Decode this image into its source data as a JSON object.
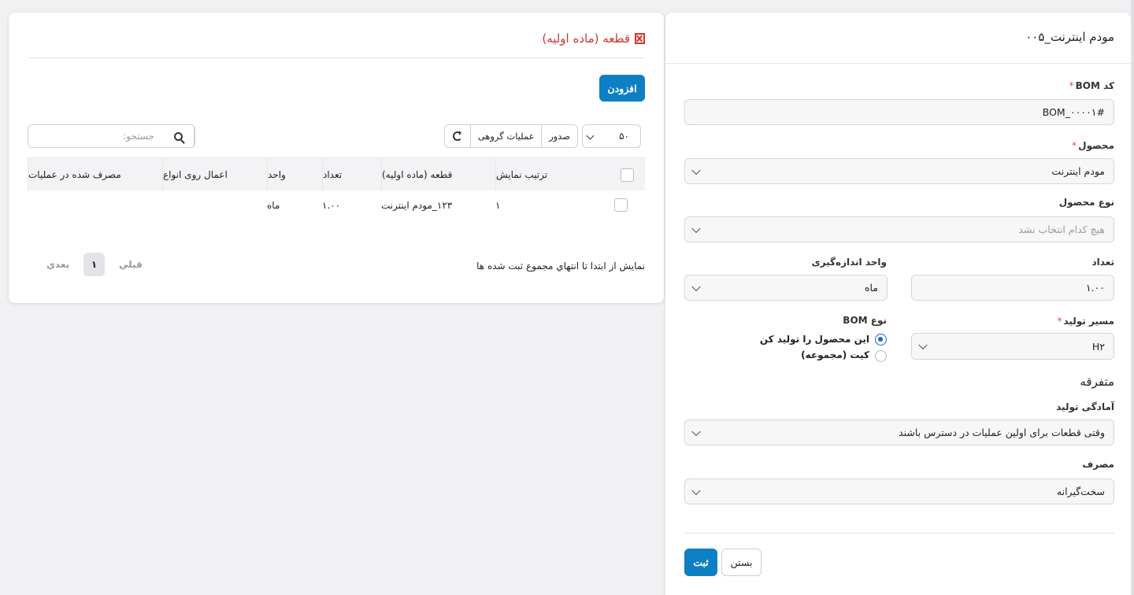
{
  "form": {
    "title": "۰۰۵_مودم اینترنت",
    "bom_code_label": "کد BOM",
    "bom_code_value": "BOM_۰۰۰۰۱#",
    "product_label": "محصول",
    "product_value": "مودم اینترنت",
    "product_type_label": "نوع محصول",
    "product_type_placeholder": "هیچ کدام انتخاب نشد",
    "quantity_label": "تعداد",
    "quantity_value": "۱.۰۰",
    "uom_label": "واحد اندازه‌گیری",
    "uom_value": "ماه",
    "route_label": "مسیر تولید",
    "route_value": "H۲",
    "bom_type_label": "نوع BOM",
    "bom_type_options": [
      "این محصول را تولید کن",
      "کیت (مجموعه)"
    ],
    "bom_type_selected": 0,
    "misc_title": "متفرقه",
    "readiness_label": "آمادگی تولید",
    "readiness_value": "وقتی قطعات برای اولین عملیات در دسترس باشند",
    "consumption_label": "مصرف",
    "consumption_value": "سخت‌گیرانه",
    "save_label": "ثبت",
    "close_label": "بستن",
    "required_mark": "*"
  },
  "lines": {
    "title": "قطعه (ماده اولیه)",
    "add_label": "افزودن",
    "page_size_value": "۵۰",
    "export_label": "صدور",
    "bulk_actions_label": "عملیات گروهی",
    "search_placeholder": "جستجو:",
    "columns": [
      "ترتیب نمایش",
      "قطعه (ماده اولیه)",
      "تعداد",
      "واحد",
      "اعمال روی انواع",
      "مصرف شده در عملیات"
    ],
    "rows": [
      {
        "sequence": "۱",
        "component": "۱۲۳_مودم اینترنت",
        "quantity": "۱.۰۰",
        "unit": "ماه",
        "apply_on_variants": "",
        "consumed_in_operation": ""
      }
    ],
    "info_text": "نمایش از ابتدا تا انتهاي مجموع ثبت شده ها",
    "prev_label": "قبلي",
    "next_label": "بعدي",
    "current_page": "۱"
  },
  "colors": {
    "primary": "#0d7fc4",
    "title_red": "#d0342c",
    "required": "#e0436b",
    "radio_blue": "#1a62d8"
  }
}
